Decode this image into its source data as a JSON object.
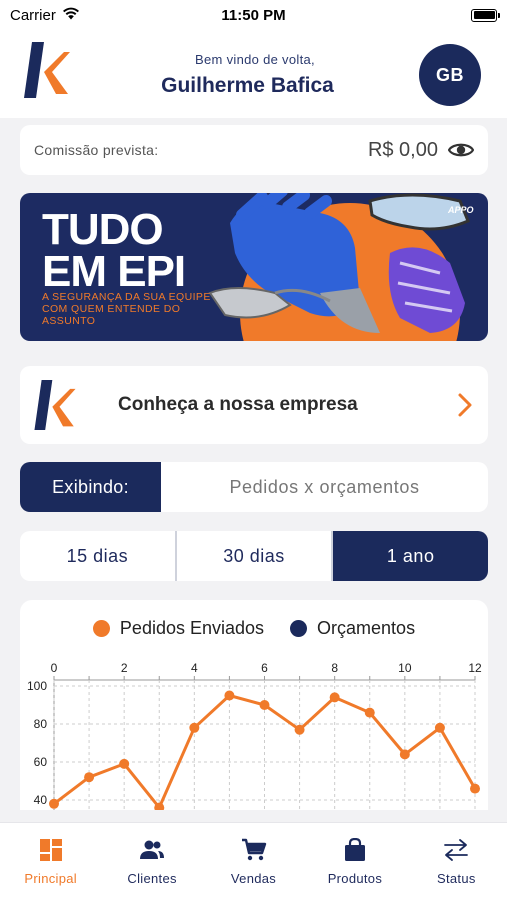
{
  "status_bar": {
    "carrier": "Carrier",
    "time": "11:50 PM"
  },
  "header": {
    "welcome": "Bem vindo de volta,",
    "user_name": "Guilherme Bafica",
    "avatar_initials": "GB"
  },
  "commission": {
    "label": "Comissão prevista:",
    "value": "R$ 0,00"
  },
  "banner": {
    "title_line1": "TUDO",
    "title_line2": "EM EPI",
    "subtitle": "A SEGURANÇA DA SUA EQUIPE COM QUEM ENTENDE DO ASSUNTO",
    "brand_mark": "APPO"
  },
  "company": {
    "label": "Conheça a nossa empresa"
  },
  "exhibit": {
    "label": "Exibindo:",
    "value": "Pedidos x orçamentos"
  },
  "periods": [
    {
      "label": "15 dias",
      "active": false
    },
    {
      "label": "30 dias",
      "active": false
    },
    {
      "label": "1 ano",
      "active": true
    }
  ],
  "chart_data": {
    "type": "line",
    "series": [
      {
        "name": "Pedidos Enviados",
        "color": "#f07a2a",
        "x": [
          0,
          1,
          2,
          3,
          4,
          5,
          6,
          7,
          8,
          9,
          10,
          11,
          12
        ],
        "values": [
          38,
          52,
          59,
          36,
          78,
          95,
          90,
          77,
          94,
          86,
          64,
          78,
          46
        ]
      },
      {
        "name": "Orçamentos",
        "color": "#1b2a5c",
        "x": [],
        "values": []
      }
    ],
    "x_ticks": [
      0,
      2,
      4,
      6,
      8,
      10,
      12
    ],
    "y_ticks": [
      40,
      60,
      80,
      100
    ],
    "xlim": [
      0,
      12
    ],
    "ylim": [
      40,
      100
    ],
    "x_axis_position": "top",
    "grid": true,
    "legend_position": "top-center"
  },
  "colors": {
    "accent": "#f07a2a",
    "brand_navy": "#1b2a5c"
  },
  "tabs": [
    {
      "label": "Principal",
      "icon": "dashboard-icon",
      "active": true
    },
    {
      "label": "Clientes",
      "icon": "users-icon",
      "active": false
    },
    {
      "label": "Vendas",
      "icon": "cart-icon",
      "active": false
    },
    {
      "label": "Produtos",
      "icon": "bag-icon",
      "active": false
    },
    {
      "label": "Status",
      "icon": "swap-arrows-icon",
      "active": false
    }
  ]
}
